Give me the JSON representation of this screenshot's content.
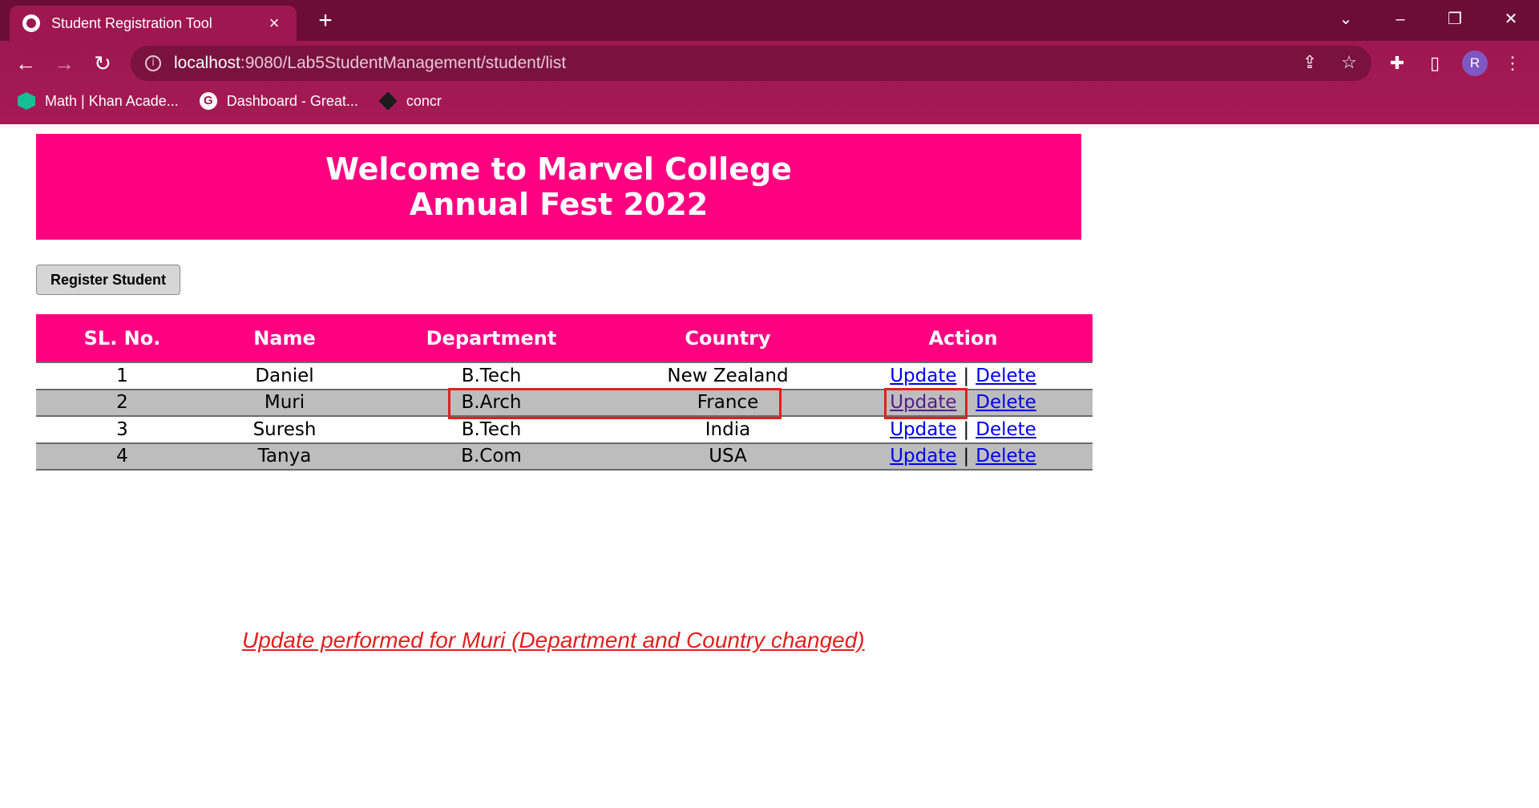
{
  "browser": {
    "tab_title": "Student Registration Tool",
    "url_host": "localhost",
    "url_path": ":9080/Lab5StudentManagement/student/list",
    "profile_initial": "R",
    "bookmarks": [
      {
        "label": "Math | Khan Acade...",
        "icon": "khan-academy-icon"
      },
      {
        "label": "Dashboard - Great...",
        "icon": "google-icon"
      },
      {
        "label": "concr",
        "icon": "concr-icon"
      }
    ]
  },
  "banner": {
    "line1": "Welcome to Marvel College",
    "line2": "Annual Fest 2022"
  },
  "register_button_label": "Register Student",
  "table": {
    "headers": [
      "SL. No.",
      "Name",
      "Department",
      "Country",
      "Action"
    ],
    "rows": [
      {
        "sl": "1",
        "name": "Daniel",
        "department": "B.Tech",
        "country": "New Zealand"
      },
      {
        "sl": "2",
        "name": "Muri",
        "department": "B.Arch",
        "country": "France"
      },
      {
        "sl": "3",
        "name": "Suresh",
        "department": "B.Tech",
        "country": "India"
      },
      {
        "sl": "4",
        "name": "Tanya",
        "department": "B.Com",
        "country": "USA"
      }
    ],
    "update_label": "Update",
    "delete_label": "Delete",
    "separator": "|"
  },
  "annotation": "Update performed for Muri (Department and Country changed)",
  "colors": {
    "chrome_dark": "#6b0d36",
    "chrome": "#9e1750",
    "banner": "#ff0080",
    "alt_row": "#bdbdbd",
    "highlight": "#e02020"
  }
}
